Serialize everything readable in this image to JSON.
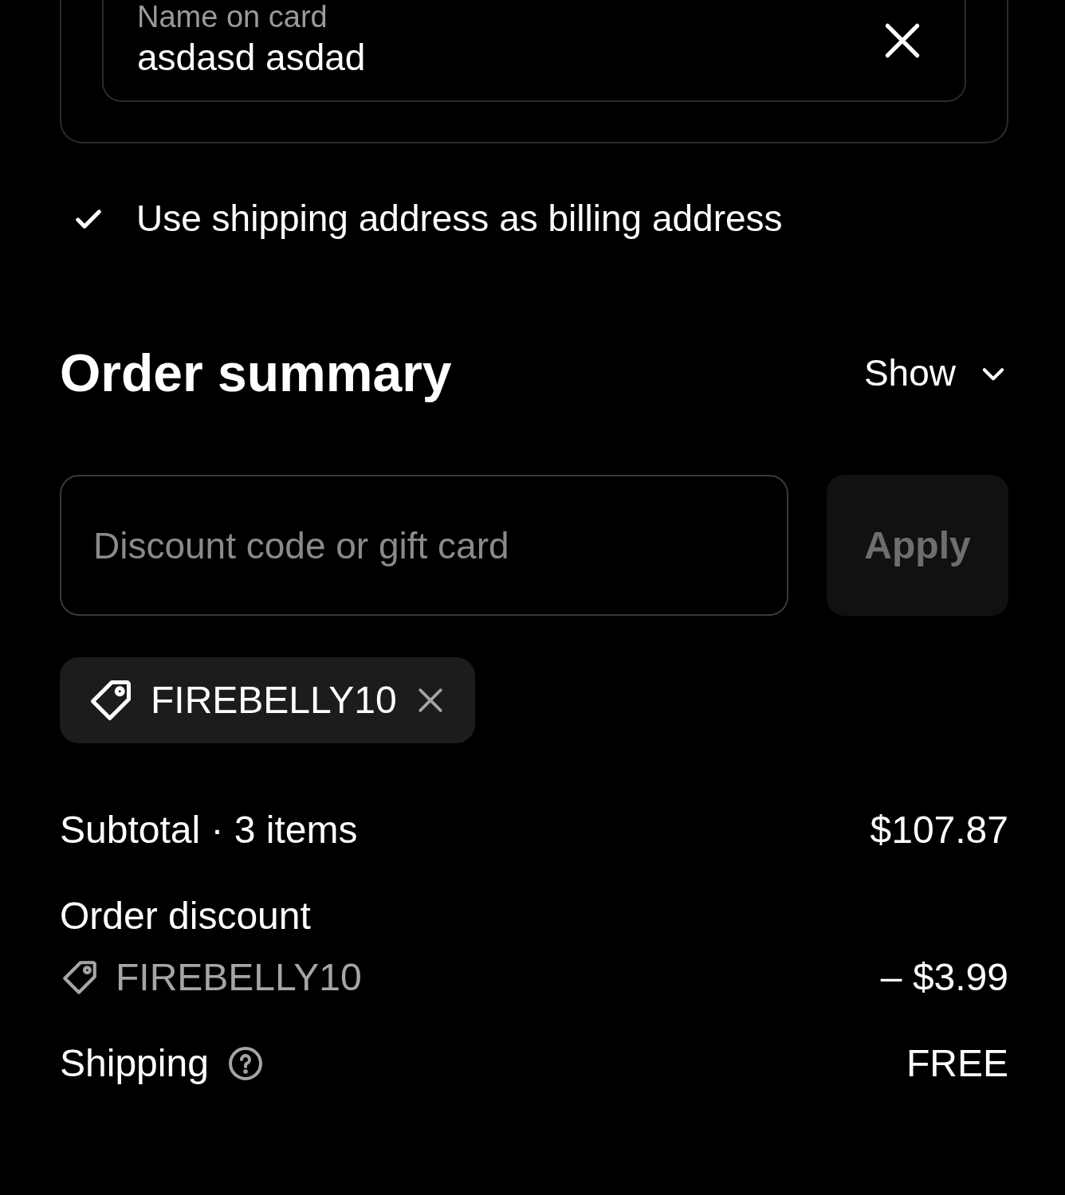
{
  "name_field": {
    "label": "Name on card",
    "value": "asdasd asdad"
  },
  "billing_checkbox": {
    "label": "Use shipping address as billing address",
    "checked": true
  },
  "order_summary": {
    "title": "Order summary",
    "toggle": "Show",
    "expanded": false
  },
  "discount": {
    "placeholder": "Discount code or gift card",
    "button": "Apply",
    "disabled": true
  },
  "applied_codes": [
    {
      "code": "FIREBELLY10"
    }
  ],
  "lines": [
    {
      "kind": "plain",
      "label": "Subtotal · 3 items",
      "value": "$107.87"
    },
    {
      "kind": "heading",
      "label": "Order discount"
    },
    {
      "kind": "code",
      "label": "FIREBELLY10",
      "value": "– $3.99"
    },
    {
      "kind": "help",
      "label": "Shipping",
      "value": "FREE"
    }
  ]
}
